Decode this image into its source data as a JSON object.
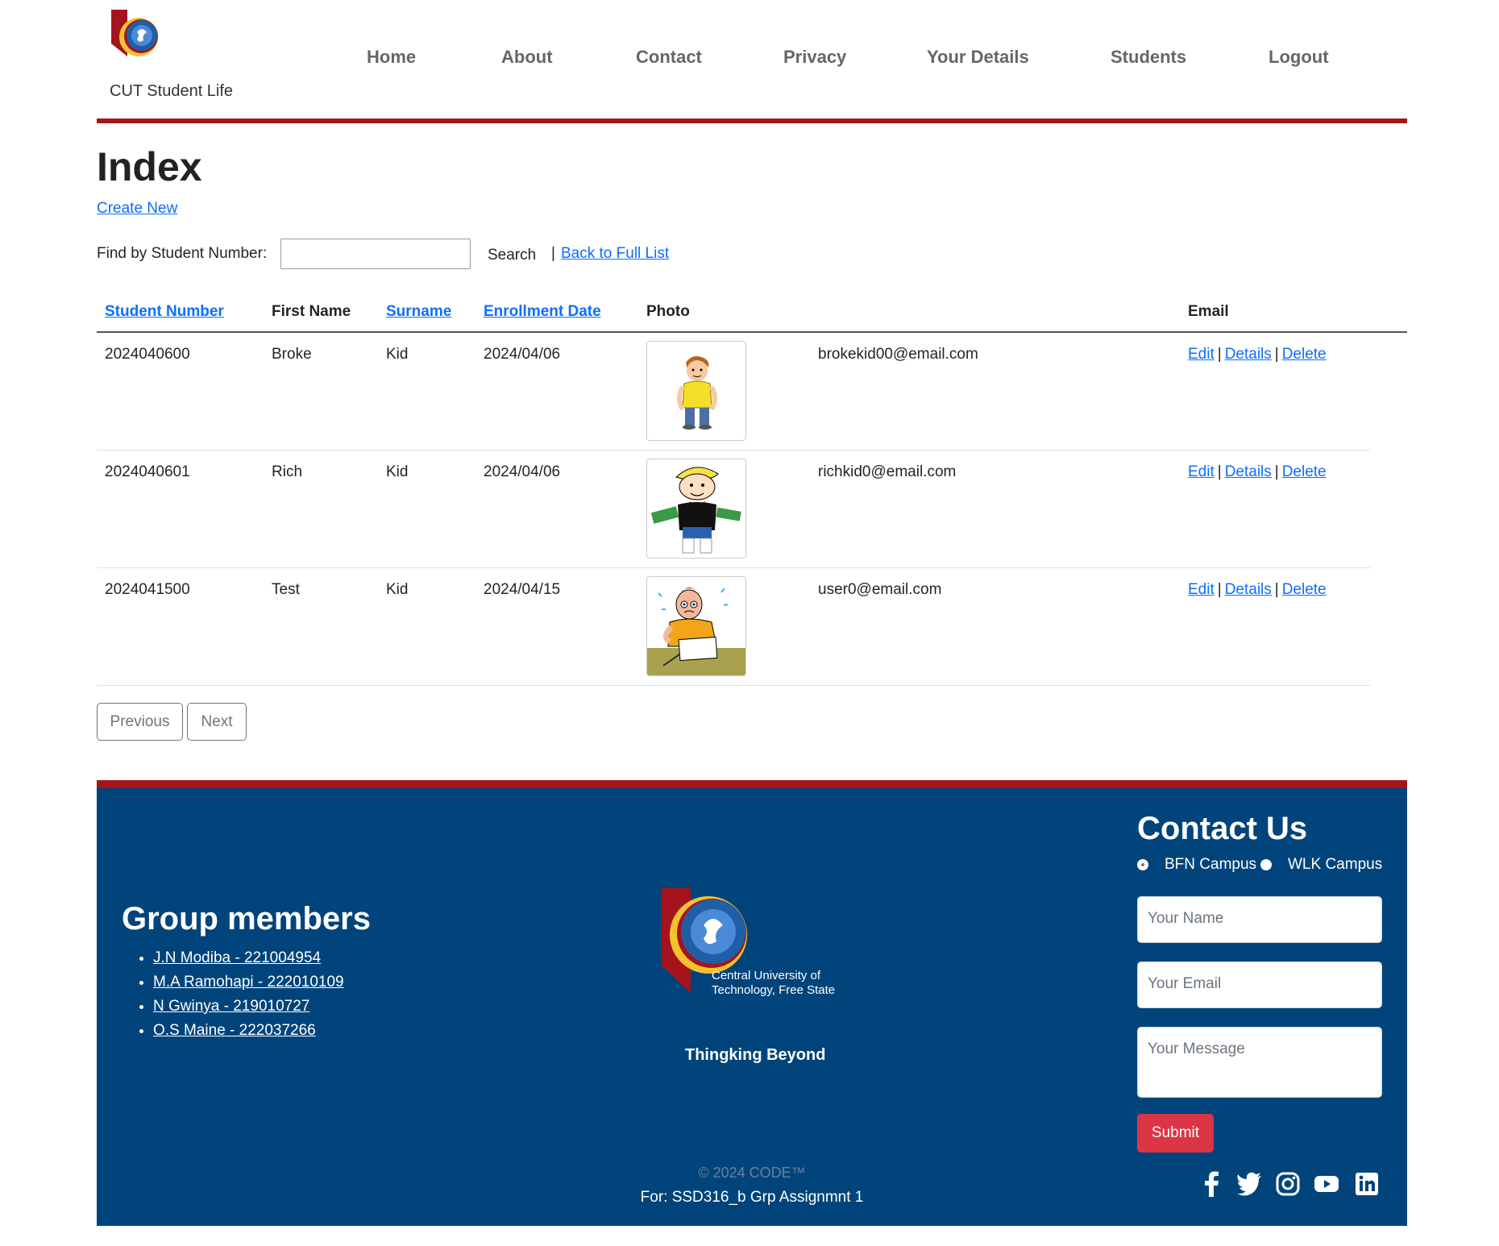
{
  "brand": {
    "name": "CUT Student Life"
  },
  "nav": [
    "Home",
    "About",
    "Contact",
    "Privacy",
    "Your Details",
    "Students",
    "Logout"
  ],
  "main": {
    "title": "Index",
    "create_new": "Create New",
    "search": {
      "label": "Find by Student Number:",
      "value": "",
      "button": "Search",
      "separator": "|",
      "back_link": "Back to Full List"
    },
    "table": {
      "headers": [
        "Student Number",
        "First Name",
        "Surname",
        "Enrollment Date",
        "Photo",
        "Email"
      ],
      "rows": [
        {
          "student_number": "2024040600",
          "first_name": "Broke",
          "surname": "Kid",
          "enrollment_date": "2024/04/06",
          "email": "brokekid00@email.com",
          "photo": "broke-kid-cartoon"
        },
        {
          "student_number": "2024040601",
          "first_name": "Rich",
          "surname": "Kid",
          "enrollment_date": "2024/04/06",
          "email": "richkid0@email.com",
          "photo": "rich-kid-cartoon"
        },
        {
          "student_number": "2024041500",
          "first_name": "Test",
          "surname": "Kid",
          "enrollment_date": "2024/04/15",
          "email": "user0@email.com",
          "photo": "test-kid-cartoon"
        }
      ],
      "actions": {
        "edit": "Edit",
        "details": "Details",
        "delete": "Delete",
        "separator": "|"
      }
    },
    "pager": {
      "previous": "Previous",
      "next": "Next"
    }
  },
  "footer": {
    "group_title": "Group members",
    "members": [
      "J.N Modiba - 221004954",
      "M.A Ramohapi - 222010109",
      "N Gwinya - 219010727",
      "O.S Maine - 222037266"
    ],
    "logo_text_line1": "Central University of",
    "logo_text_line2": "Technology, Free State",
    "tagline": "Thingking Beyond",
    "copyright": "© 2024 CODE™",
    "for_line": "For: SSD316_b Grp Assignmnt 1",
    "contact": {
      "title": "Contact Us",
      "campus_options": [
        "BFN Campus",
        "WLK Campus"
      ],
      "selected_campus": "BFN Campus",
      "name_placeholder": "Your Name",
      "email_placeholder": "Your Email",
      "message_placeholder": "Your Message",
      "submit": "Submit"
    },
    "social_icons": [
      "facebook-icon",
      "twitter-icon",
      "instagram-icon",
      "youtube-icon",
      "linkedin-icon"
    ]
  },
  "colors": {
    "accent_red": "#a5141c",
    "footer_blue": "#00447b",
    "link_blue": "#0d6efd",
    "submit_red": "#dc3545"
  }
}
